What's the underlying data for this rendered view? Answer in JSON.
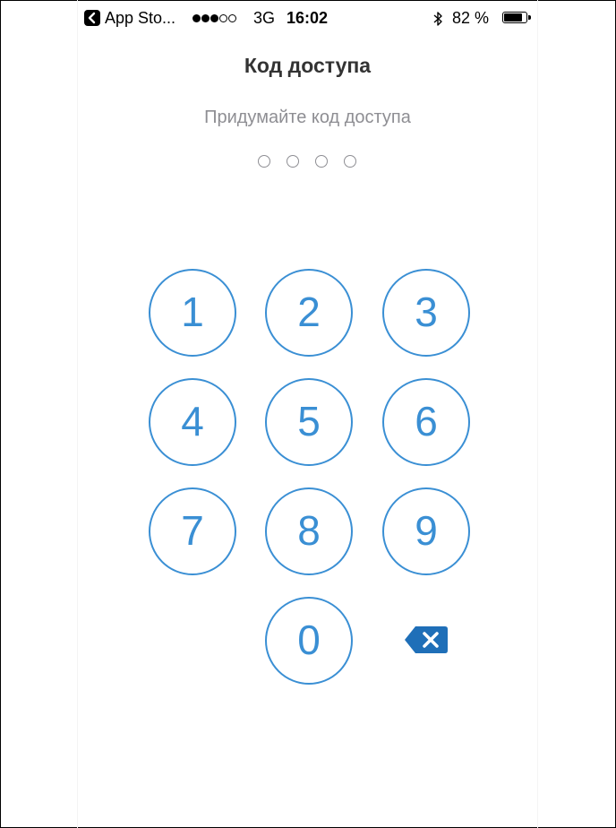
{
  "status_bar": {
    "back_app": "App Sto...",
    "network": "3G",
    "time": "16:02",
    "battery_percent_label": "82 %",
    "battery_level": 0.82,
    "signal_bars_filled": 3,
    "signal_bars_total": 5,
    "icons": [
      "back-arrow-icon",
      "signal-icon",
      "bluetooth-icon",
      "battery-icon"
    ]
  },
  "header": {
    "title": "Код доступа",
    "subtitle": "Придумайте код доступа"
  },
  "code": {
    "length": 4,
    "entered": 0
  },
  "keypad": {
    "keys": [
      "1",
      "2",
      "3",
      "4",
      "5",
      "6",
      "7",
      "8",
      "9",
      "0"
    ],
    "backspace_icon": "backspace-icon"
  },
  "colors": {
    "accent": "#3a8fd4",
    "backspace": "#1f6fb8",
    "title": "#333333",
    "subtitle": "#8e8e93"
  }
}
